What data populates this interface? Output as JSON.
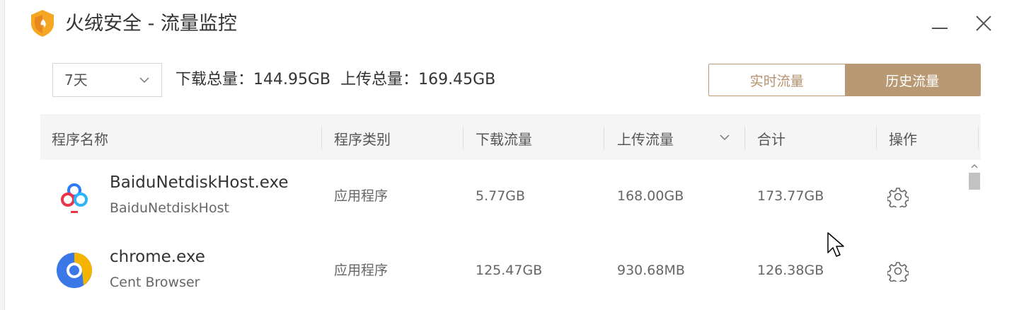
{
  "window": {
    "title": "火绒安全 - 流量监控",
    "controls": {
      "minimize_icon": "minimize-icon",
      "close_icon": "close-icon"
    }
  },
  "toolbar": {
    "range": {
      "selected": "7天"
    },
    "download_total_label": "下载总量：",
    "download_total_value": "144.95GB",
    "upload_total_label": "上传总量：",
    "upload_total_value": "169.45GB",
    "tabs": [
      {
        "label": "实时流量",
        "active": false
      },
      {
        "label": "历史流量",
        "active": true
      }
    ]
  },
  "table": {
    "columns": [
      "程序名称",
      "程序类别",
      "下载流量",
      "上传流量",
      "合计",
      "操作"
    ],
    "sorted_column": "上传流量",
    "rows": [
      {
        "name": "BaiduNetdiskHost.exe",
        "description": "BaiduNetdiskHost",
        "category": "应用程序",
        "download": "5.77GB",
        "upload": "168.00GB",
        "total": "173.77GB",
        "icon": "baidu-netdisk-icon"
      },
      {
        "name": "chrome.exe",
        "description": "Cent Browser",
        "category": "应用程序",
        "download": "125.47GB",
        "upload": "930.68MB",
        "total": "126.38GB",
        "icon": "cent-browser-icon"
      }
    ]
  },
  "colors": {
    "accent": "#b99874",
    "accent_text": "#b4926c",
    "header_bg": "#f5f5f5",
    "logo_orange": "#f5a623"
  }
}
